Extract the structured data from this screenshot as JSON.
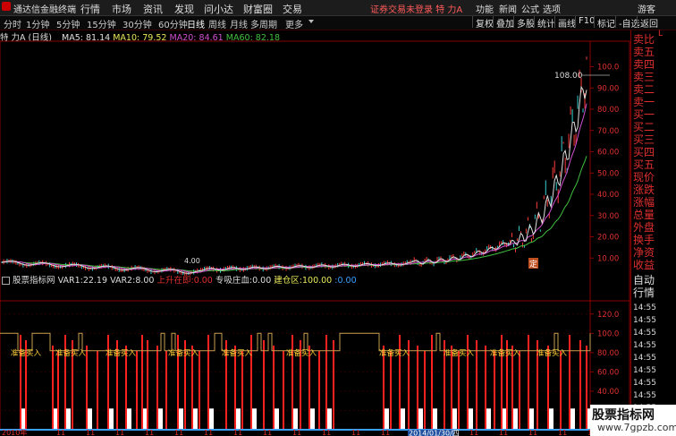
{
  "topbar": {
    "app_name": "通达信金融终端",
    "menu": [
      "行情",
      "市场",
      "资讯",
      "发现",
      "问小达",
      "财富圈",
      "交易"
    ],
    "status": "证券交易未登录  特 力A",
    "right_menu": [
      "功能",
      "新闻",
      "公式",
      "选项"
    ],
    "user": "游客"
  },
  "toolbar": {
    "periods": [
      "分时",
      "1分钟",
      "5分钟",
      "15分钟",
      "30分钟",
      "60分钟",
      "日线",
      "周线",
      "月线",
      "多周期",
      "更多"
    ],
    "active_period": "日线",
    "right_buttons": [
      "复权",
      "叠加",
      "多股",
      "统计",
      "画线",
      "F10",
      "标记",
      "-自选",
      "返回"
    ]
  },
  "main_chart": {
    "stock_label": "特 力A (日线)",
    "ma": [
      {
        "name": "MA5",
        "value": "81.14",
        "color": "#e0e0e0"
      },
      {
        "name": "MA10",
        "value": "79.52",
        "color": "#e8e85a"
      },
      {
        "name": "MA20",
        "value": "84.61",
        "color": "#d050d0"
      },
      {
        "name": "MA60",
        "value": "82.18",
        "color": "#40c040"
      }
    ],
    "y_ticks": [
      "100.0",
      "90.00",
      "80.00",
      "70.00",
      "60.00",
      "50.00",
      "40.00",
      "30.00",
      "20.00",
      "10.00"
    ],
    "high_label": "108.00",
    "low_label": "4.00",
    "marker": "定"
  },
  "indicator": {
    "name": "股票指标网",
    "vars": [
      {
        "label": "VAR1:",
        "value": "22.19",
        "color": "#ddd"
      },
      {
        "label": "VAR2:",
        "value": "8.00",
        "color": "#ddd"
      },
      {
        "label": "上升在即:",
        "value": "0.00",
        "color": "#e03030"
      },
      {
        "label": "专吸庄血:",
        "value": "0.00",
        "color": "#ddd"
      },
      {
        "label": "建仓区:",
        "value": "100.00",
        "color": "#e8e85a"
      },
      {
        "label": ":",
        "value": "0.00",
        "color": "#3aa0ff"
      }
    ],
    "y_ticks": [
      "120.0",
      "100.0",
      "80.00",
      "60.00",
      "40.00",
      "20.00"
    ],
    "signal_text": "准备买入"
  },
  "timeline": {
    "labels": [
      "2010年",
      "11",
      "11",
      "11",
      "11",
      "11",
      "11",
      "11",
      "11",
      "11",
      "11",
      "11",
      "11",
      "11",
      "11",
      "11",
      "11",
      "11",
      "11",
      "11"
    ],
    "highlight": "2014/01/30/四"
  },
  "right_panel": {
    "labels": [
      "卖比",
      "卖五",
      "卖四",
      "卖三",
      "卖二",
      "卖一",
      "买一",
      "买二",
      "买三",
      "买四",
      "买五",
      "现价",
      "涨跌",
      "涨幅",
      "总量",
      "外盘",
      "换手",
      "净资",
      "收益"
    ],
    "bottom": [
      "自动",
      "行情"
    ],
    "times": [
      "14:55",
      "14:55",
      "14:55",
      "14:55",
      "14:55",
      "14:55",
      "14:55",
      "14:55",
      "14:55",
      "14:55"
    ],
    "l_label": "L"
  },
  "watermark": {
    "title": "股票指标网",
    "url": "www.7gpzb.com"
  },
  "colors": {
    "accent_red": "#e03030",
    "ma5": "#e0e0e0",
    "ma10": "#e8e85a",
    "ma20": "#d050d0",
    "ma60": "#40c040",
    "signal_gold": "#c8a050",
    "bar_red": "#ff2020",
    "bar_white": "#ffffff",
    "axis_blue": "#3aa0ff"
  }
}
